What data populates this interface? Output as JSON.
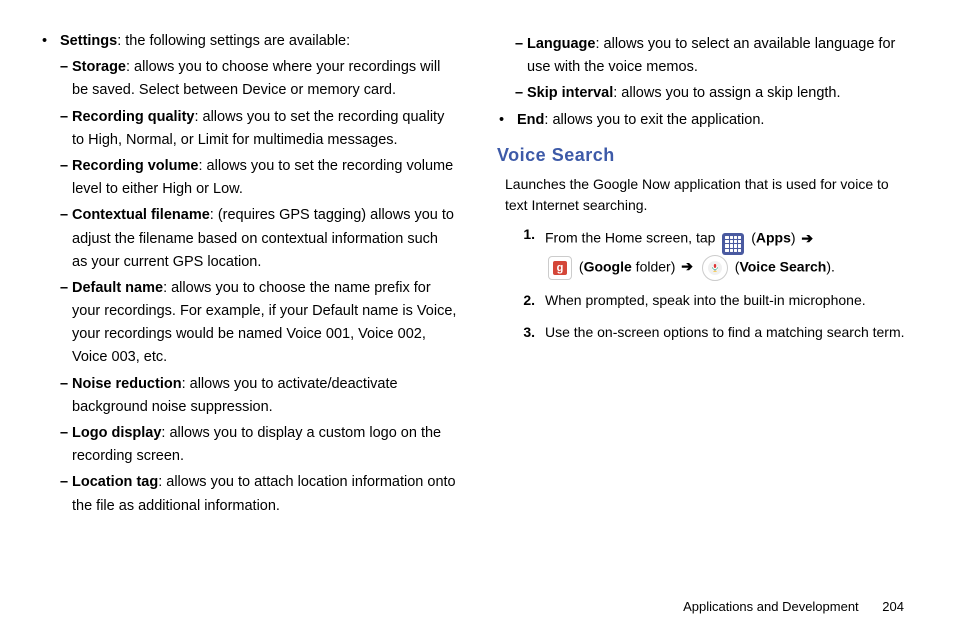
{
  "left": {
    "settings_label": "Settings",
    "settings_intro": ": the following settings are available:",
    "sub": [
      {
        "label": "Storage",
        "text": ": allows you to choose where your recordings will be saved. Select between Device or memory card."
      },
      {
        "label": "Recording quality",
        "text": ": allows you to set the recording quality to High, Normal, or Limit for multimedia messages."
      },
      {
        "label": "Recording volume",
        "text": ": allows you to set the recording volume level to either High or Low."
      },
      {
        "label": "Contextual filename",
        "text": ": (requires GPS tagging) allows you to adjust the filename based on contextual information such as your current GPS location."
      },
      {
        "label": "Default name",
        "text": ": allows you to choose the name prefix for your recordings. For example, if your Default name is Voice, your recordings would be named Voice 001, Voice 002, Voice 003, etc."
      },
      {
        "label": "Noise reduction",
        "text": ": allows you to activate/deactivate background noise suppression."
      },
      {
        "label": "Logo display",
        "text": ": allows you to display a custom logo on the recording screen."
      },
      {
        "label": "Location tag",
        "text": ": allows you to attach location information onto the file as additional information."
      }
    ]
  },
  "right": {
    "cont_sub": [
      {
        "label": "Language",
        "text": ": allows you to select an available language for use with the voice memos."
      },
      {
        "label": "Skip interval",
        "text": ": allows you to assign a skip length."
      }
    ],
    "end_label": "End",
    "end_text": ": allows you to exit the application.",
    "heading": "Voice Search",
    "intro": "Launches the Google Now application that is used for voice to text Internet searching.",
    "step1_pre": "From the Home screen, tap ",
    "apps_label": "Apps",
    "google_folder_pre": " (",
    "google_folder_bold": "Google",
    "google_folder_post": " folder) ",
    "voice_search_label": "Voice Search",
    "step2": "When prompted, speak into the built-in microphone.",
    "step3": "Use the on-screen options to find a matching search term.",
    "steps_num": {
      "1": "1.",
      "2": "2.",
      "3": "3."
    },
    "arrow": "➔",
    "paren_open": " (",
    "paren_close": ") ",
    "paren_close_dot": ")."
  },
  "footer": {
    "section": "Applications and Development",
    "page": "204"
  },
  "glyphs": {
    "g": "g"
  }
}
